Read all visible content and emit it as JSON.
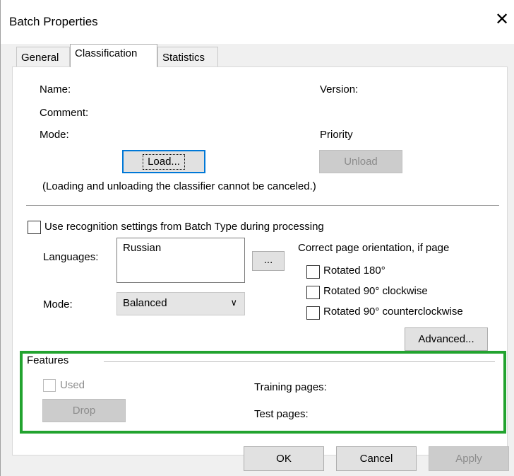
{
  "window": {
    "title": "Batch Properties"
  },
  "tabs": [
    {
      "label": "General",
      "active": false
    },
    {
      "label": "Classification",
      "active": true
    },
    {
      "label": "Statistics",
      "active": false
    }
  ],
  "classifier": {
    "name_label": "Name:",
    "version_label": "Version:",
    "comment_label": "Comment:",
    "mode_label": "Mode:",
    "priority_label": "Priority",
    "load_button": "Load...",
    "unload_button": "Unload",
    "note": "(Loading and unloading the classifier cannot be canceled.)"
  },
  "recognition": {
    "use_batch_type_label": "Use recognition settings from Batch Type during processing",
    "languages_label": "Languages:",
    "languages_value": "Russian",
    "languages_button": "...",
    "mode_label": "Mode:",
    "mode_value": "Balanced",
    "orientation_heading": "Correct page orientation, if page",
    "rotated_180": "Rotated 180°",
    "rotated_90_cw": "Rotated 90° clockwise",
    "rotated_90_ccw": "Rotated 90° counterclockwise",
    "advanced_button": "Advanced..."
  },
  "features": {
    "group_label": "Features",
    "used_label": "Used",
    "drop_button": "Drop",
    "training_pages_label": "Training pages:",
    "test_pages_label": "Test pages:",
    "highlight_color": "#22a32f"
  },
  "footer": {
    "ok": "OK",
    "cancel": "Cancel",
    "apply": "Apply"
  },
  "icons": {
    "close": "close-icon",
    "dropdown": "chevron-down-icon"
  }
}
